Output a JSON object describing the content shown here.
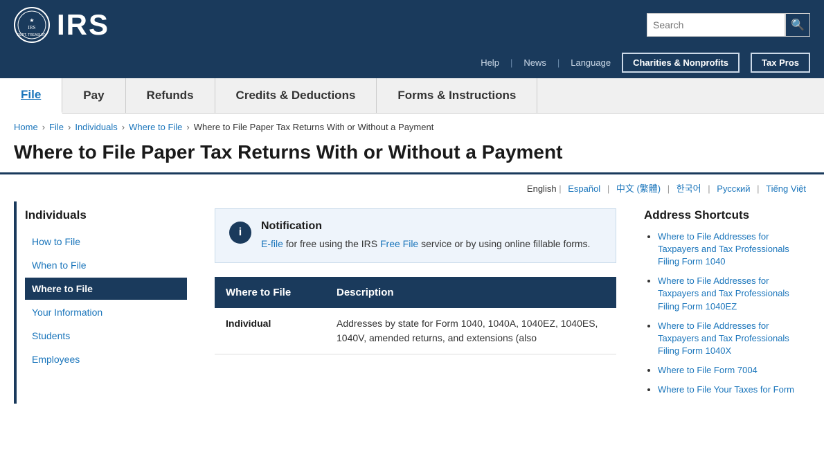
{
  "header": {
    "logo_text": "IRS",
    "search_placeholder": "Search"
  },
  "secondary_nav": {
    "help": "Help",
    "news": "News",
    "language": "Language",
    "charities_btn": "Charities & Nonprofits",
    "taxpros_btn": "Tax Pros"
  },
  "main_nav": {
    "items": [
      {
        "id": "file",
        "label": "File",
        "active": true
      },
      {
        "id": "pay",
        "label": "Pay",
        "active": false
      },
      {
        "id": "refunds",
        "label": "Refunds",
        "active": false
      },
      {
        "id": "credits",
        "label": "Credits & Deductions",
        "active": false
      },
      {
        "id": "forms",
        "label": "Forms & Instructions",
        "active": false
      }
    ]
  },
  "breadcrumb": {
    "items": [
      {
        "label": "Home",
        "href": "#"
      },
      {
        "label": "File",
        "href": "#"
      },
      {
        "label": "Individuals",
        "href": "#"
      },
      {
        "label": "Where to File",
        "href": "#"
      },
      {
        "label": "Where to File Paper Tax Returns With or Without a Payment",
        "href": null
      }
    ]
  },
  "page_title": "Where to File Paper Tax Returns With or Without a Payment",
  "lang_bar": {
    "active": "English",
    "links": [
      {
        "label": "Español",
        "href": "#"
      },
      {
        "label": "中文 (繁體)",
        "href": "#"
      },
      {
        "label": "한국어",
        "href": "#"
      },
      {
        "label": "Русский",
        "href": "#"
      },
      {
        "label": "Tiếng Việt",
        "href": "#"
      }
    ]
  },
  "sidebar": {
    "section_title": "Individuals",
    "links": [
      {
        "label": "How to File",
        "active": false
      },
      {
        "label": "When to File",
        "active": false
      },
      {
        "label": "Where to File",
        "active": true
      },
      {
        "label": "Your Information",
        "active": false
      },
      {
        "label": "Students",
        "active": false
      },
      {
        "label": "Employees",
        "active": false
      }
    ]
  },
  "notification": {
    "icon": "i",
    "title": "Notification",
    "text_before_link": "E-file",
    "text_link1_label": "E-file",
    "text_link1_href": "#",
    "text_middle": " for free using the IRS ",
    "text_link2_label": "Free File",
    "text_link2_href": "#",
    "text_after": " service or by using online fillable forms."
  },
  "table": {
    "col1_header": "Where to File",
    "col2_header": "Description",
    "rows": [
      {
        "col1": "Individual",
        "col2": "Addresses by state for Form 1040, 1040A, 1040EZ, 1040ES, 1040V, amended returns, and extensions (also"
      }
    ]
  },
  "address_shortcuts": {
    "title": "Address Shortcuts",
    "links": [
      {
        "label": "Where to File Addresses for Taxpayers and Tax Professionals Filing Form 1040",
        "href": "#"
      },
      {
        "label": "Where to File Addresses for Taxpayers and Tax Professionals Filing Form 1040EZ",
        "href": "#"
      },
      {
        "label": "Where to File Addresses for Taxpayers and Tax Professionals Filing Form 1040X",
        "href": "#"
      },
      {
        "label": "Where to File Form 7004",
        "href": "#"
      },
      {
        "label": "Where to File Your Taxes for Form",
        "href": "#"
      }
    ]
  }
}
